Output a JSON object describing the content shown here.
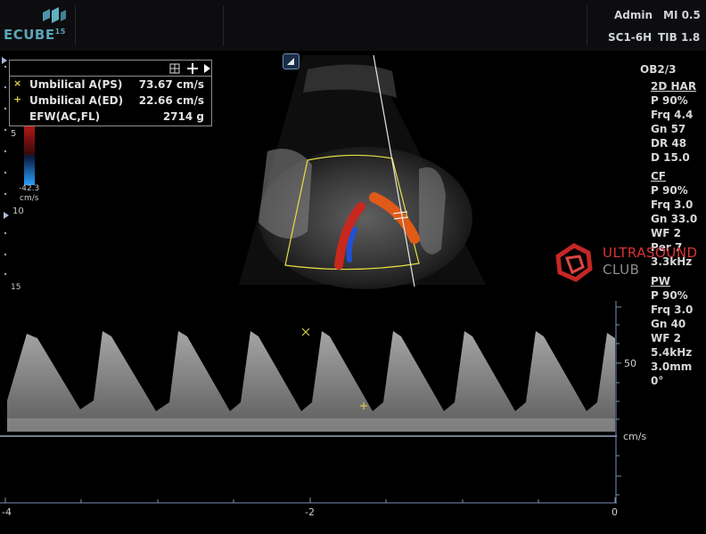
{
  "header": {
    "logo_text": "ECUBE",
    "logo_sup": "15",
    "user": "Admin",
    "mi": "MI 0.5",
    "probe": "SC1-6H",
    "tib": "TIB 1.8"
  },
  "measurements": [
    {
      "marker": "×",
      "label": "Umbilical A(PS)",
      "value": "73.67 cm/s"
    },
    {
      "marker": "+",
      "label": "Umbilical A(ED)",
      "value": "22.66 cm/s"
    },
    {
      "marker": "",
      "label": "EFW(AC,FL)",
      "value": "2714 g"
    }
  ],
  "toolbar_icons": [
    "grid-icon",
    "move-icon",
    "play-icon"
  ],
  "depth_scale": [
    "5",
    "10",
    "15"
  ],
  "color_bar": {
    "top": "5",
    "bottom": "-42.3",
    "unit": "cm/s"
  },
  "params": {
    "preset": "OB2/3",
    "sections": [
      {
        "title": "2D HAR",
        "items": [
          "P 90%",
          "Frq 4.4",
          "Gn 57",
          "DR 48",
          "D 15.0"
        ]
      },
      {
        "title": "CF",
        "items": [
          "P 90%",
          "Frq 3.0",
          "Gn 33.0",
          "WF 2",
          "Per 7",
          "3.3kHz"
        ]
      },
      {
        "title": "PW",
        "items": [
          "P 90%",
          "Frq 3.0",
          "Gn 40",
          "WF 2",
          "5.4kHz",
          "3.0mm",
          "0°"
        ]
      }
    ]
  },
  "watermark": {
    "line1": "ULTRASOUND",
    "line2": "CLUB"
  },
  "doppler": {
    "velocity_label": "50",
    "unit": "cm/s",
    "time_ticks": [
      "-4",
      "-2",
      "0"
    ]
  },
  "colors": {
    "accent": "#5aa6b8",
    "caliper": "#d9c94a",
    "sector": "#e8e040",
    "watermark": "#d33"
  }
}
